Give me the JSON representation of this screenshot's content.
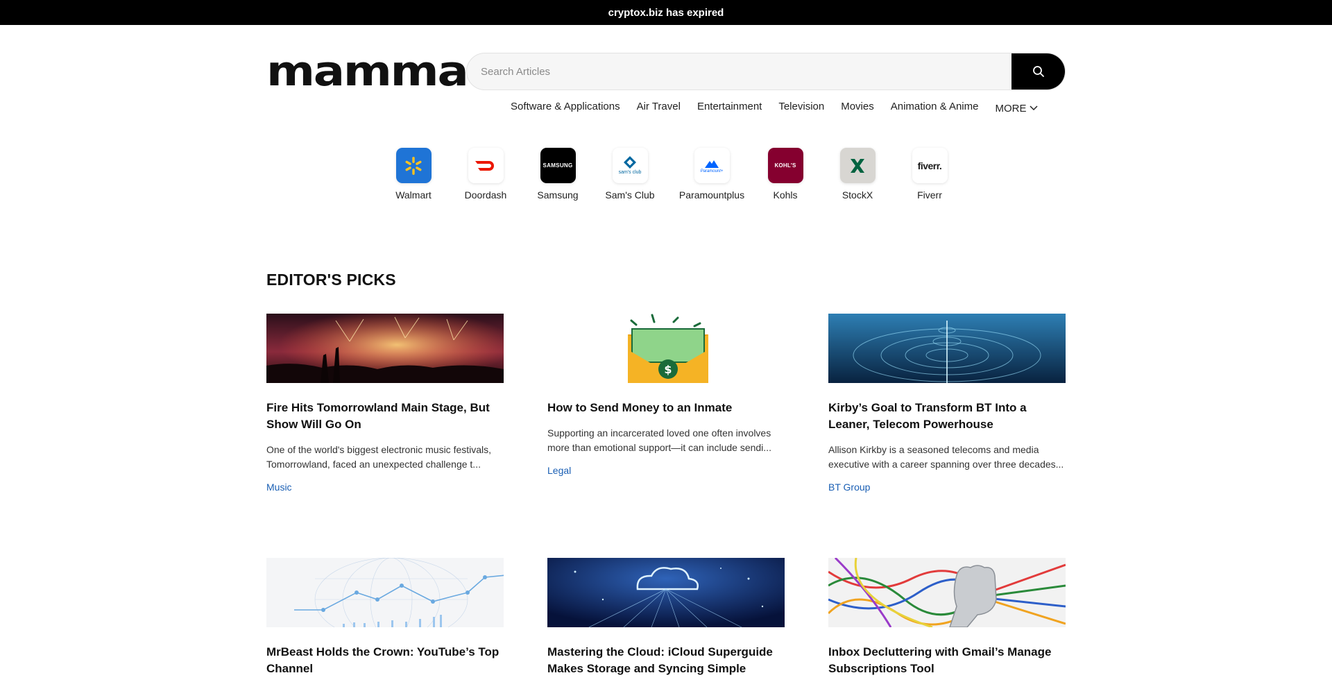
{
  "banner": {
    "text": "cryptox.biz has expired"
  },
  "logo": {
    "text": "mamma"
  },
  "search": {
    "placeholder": "Search Articles"
  },
  "nav": {
    "items": [
      "Software & Applications",
      "Air Travel",
      "Entertainment",
      "Television",
      "Movies",
      "Animation & Anime"
    ],
    "more_label": "MORE"
  },
  "brands": [
    {
      "name": "Walmart",
      "tile_text": "",
      "bg": "#1f74d6"
    },
    {
      "name": "Doordash",
      "tile_text": "",
      "bg": "#ffffff"
    },
    {
      "name": "Samsung",
      "tile_text": "SAMSUNG",
      "bg": "#000000"
    },
    {
      "name": "Sam's Club",
      "tile_text": "sam's club",
      "bg": "#ffffff"
    },
    {
      "name": "Paramountplus",
      "tile_text": "Paramount+",
      "bg": "#ffffff"
    },
    {
      "name": "Kohls",
      "tile_text": "KOHL'S",
      "bg": "#85002f"
    },
    {
      "name": "StockX",
      "tile_text": "",
      "bg": "#d8d6d2"
    },
    {
      "name": "Fiverr",
      "tile_text": "fiverr.",
      "bg": "#ffffff"
    }
  ],
  "editors_picks": {
    "title": "EDITOR'S PICKS",
    "articles": [
      {
        "title": "Fire Hits Tomorrowland Main Stage, But Show Will Go On",
        "excerpt": "One of the world's biggest electronic music festivals, Tomorrowland, faced an unexpected challenge t...",
        "category": "Music"
      },
      {
        "title": "How to Send Money to an Inmate",
        "excerpt": "Supporting an incarcerated loved one often involves more than emotional support—it can include sendi...",
        "category": "Legal"
      },
      {
        "title": "Kirby’s Goal to Transform BT Into a Leaner, Telecom Powerhouse",
        "excerpt": "Allison Kirkby is a seasoned telecoms and media executive with a career spanning over three decades...",
        "category": "BT Group"
      },
      {
        "title": "MrBeast Holds the Crown: YouTube’s Top Channel",
        "excerpt": "",
        "category": ""
      },
      {
        "title": "Mastering the Cloud: iCloud Superguide Makes Storage and Syncing Simple",
        "excerpt": "",
        "category": ""
      },
      {
        "title": "Inbox Decluttering with Gmail’s Manage Subscriptions Tool",
        "excerpt": "",
        "category": ""
      }
    ]
  },
  "colors": {
    "accent_link": "#1a5fb4",
    "banner_bg": "#000000",
    "search_button": "#000000"
  }
}
